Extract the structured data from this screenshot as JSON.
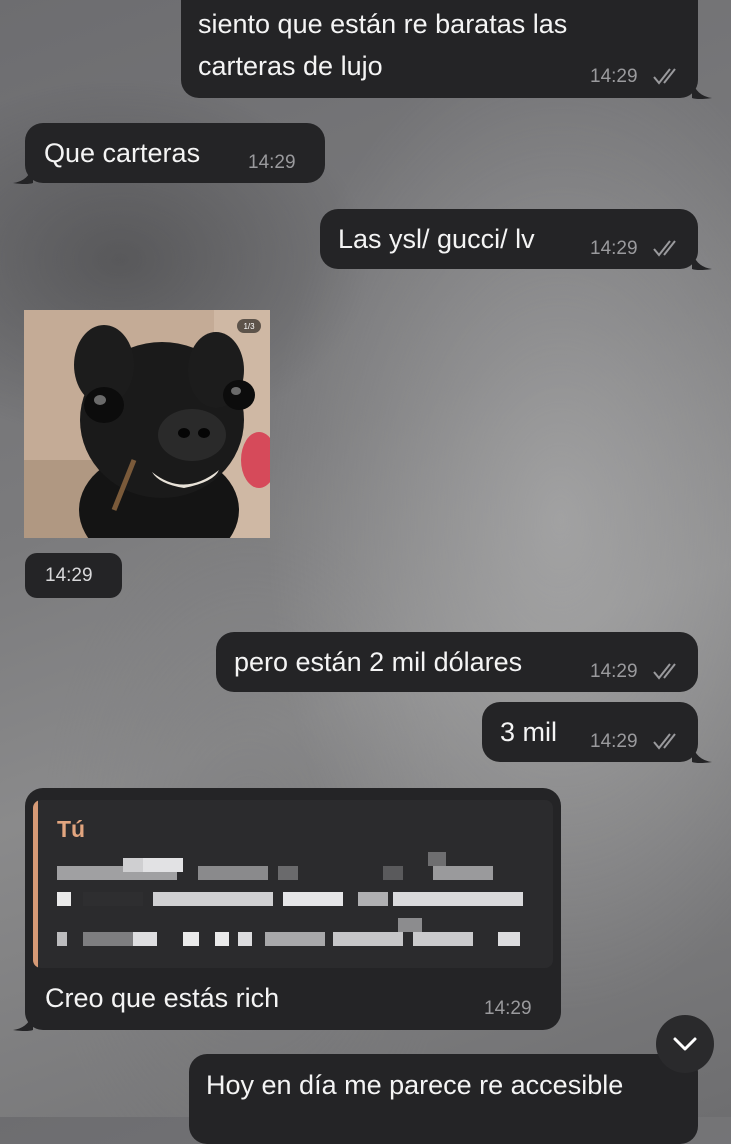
{
  "messages": [
    {
      "id": "m1",
      "direction": "outgoing",
      "lines": [
        "siento que están re baratas las",
        "carteras de lujo"
      ],
      "time": "14:29",
      "read": true
    },
    {
      "id": "m2",
      "direction": "incoming",
      "text": "Que carteras",
      "time": "14:29"
    },
    {
      "id": "m3",
      "direction": "outgoing",
      "text": "Las ysl/ gucci/ lv",
      "time": "14:29",
      "read": true
    },
    {
      "id": "m4",
      "direction": "incoming",
      "type": "photo",
      "counter": "1/3",
      "time": "14:29"
    },
    {
      "id": "m5",
      "direction": "outgoing",
      "text": "pero están 2 mil dólares",
      "time": "14:29",
      "read": true
    },
    {
      "id": "m6",
      "direction": "outgoing",
      "text": "3 mil",
      "time": "14:29",
      "read": true
    },
    {
      "id": "m7",
      "direction": "incoming",
      "reply_to": "Tú",
      "text": "Creo que estás rich",
      "time": "14:29"
    },
    {
      "id": "m8",
      "direction": "outgoing",
      "text": "Hoy en día me parece re accesible"
    }
  ],
  "icons": {
    "read_receipt": "double-check-icon",
    "scroll": "chevron-down-icon"
  },
  "colors": {
    "bubble": "#242426",
    "quote_accent": "#d69a76",
    "text": "#f4f4f4",
    "time": "#9a9a9d"
  }
}
